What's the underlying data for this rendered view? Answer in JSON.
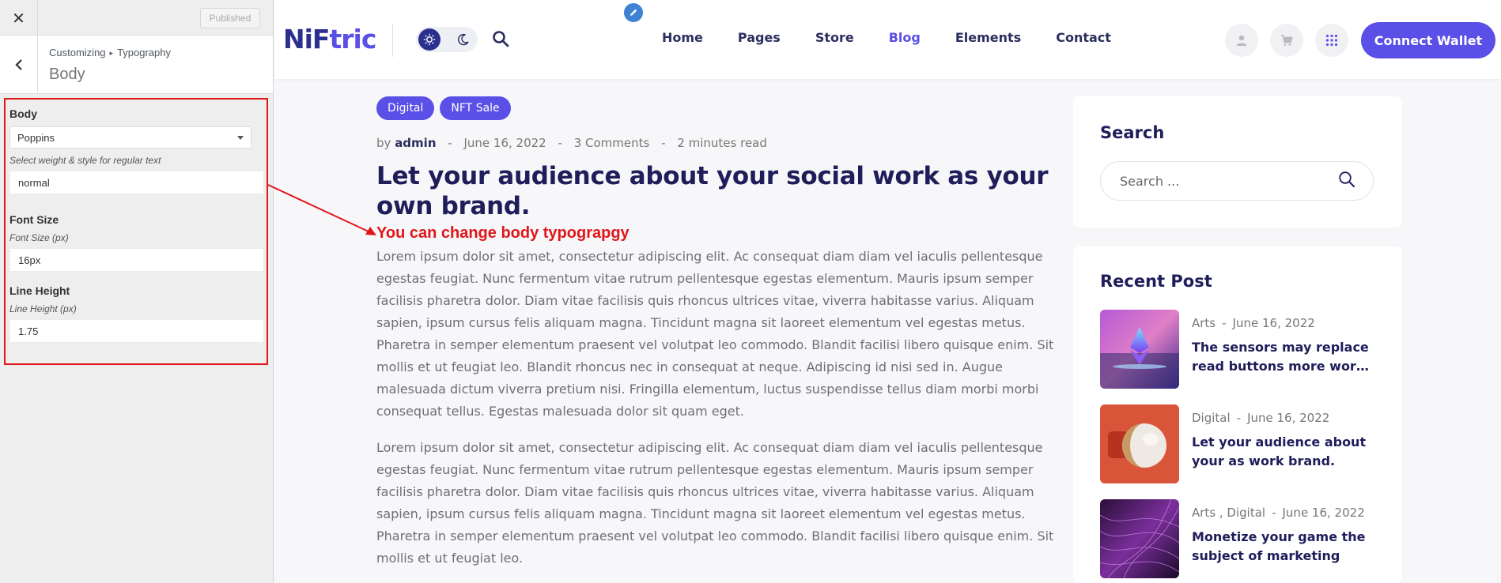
{
  "customizer": {
    "close_icon": "close-icon",
    "published_label": "Published",
    "breadcrumb_root": "Customizing",
    "breadcrumb_leaf": "Typography",
    "section_title": "Body",
    "body_label": "Body",
    "font_family_value": "Poppins",
    "weight_desc": "Select weight & style for regular text",
    "weight_value": "normal",
    "font_size_label": "Font Size",
    "font_size_desc": "Font Size (px)",
    "font_size_value": "16px",
    "line_height_label": "Line Height",
    "line_height_desc": "Line Height (px)",
    "line_height_value": "1.75",
    "highlight_color": "#e0161a"
  },
  "header": {
    "logo_part1": "NiF",
    "logo_part2": "tric",
    "nav": [
      "Home",
      "Pages",
      "Store",
      "Blog",
      "Elements",
      "Contact"
    ],
    "active_nav": "Blog",
    "cta_label": "Connect Wallet",
    "accent_color": "#5a4fe6"
  },
  "post": {
    "tags": [
      "Digital",
      "NFT Sale"
    ],
    "meta_by": "by",
    "meta_author": "admin",
    "meta_date": "June 16, 2022",
    "meta_comments": "3 Comments",
    "meta_read": "2 minutes read",
    "title": "Let your audience about your social work as your own brand.",
    "annotation": "You can change body typograpgy",
    "paragraph1": "Lorem ipsum dolor sit amet, consectetur adipiscing elit. Ac consequat diam diam vel iaculis pellentesque egestas feugiat. Nunc fermentum vitae rutrum pellentesque egestas elementum. Mauris ipsum semper facilisis pharetra dolor. Diam vitae facilisis quis rhoncus ultrices vitae, viverra habitasse varius. Aliquam sapien, ipsum cursus felis aliquam magna. Tincidunt magna sit laoreet elementum vel egestas metus. Pharetra in semper elementum praesent vel volutpat leo commodo. Blandit facilisi libero quisque enim. Sit mollis et ut feugiat leo. Blandit rhoncus nec in consequat at neque. Adipiscing id nisi sed in. Augue malesuada dictum viverra pretium nisi. Fringilla elementum, luctus suspendisse tellus diam morbi morbi consequat tellus. Egestas malesuada dolor sit quam eget.",
    "paragraph2": "Lorem ipsum dolor sit amet, consectetur adipiscing elit. Ac consequat diam diam vel iaculis pellentesque egestas feugiat. Nunc fermentum vitae rutrum pellentesque egestas elementum. Mauris ipsum semper facilisis pharetra dolor. Diam vitae facilisis quis rhoncus ultrices vitae, viverra habitasse varius. Aliquam sapien, ipsum cursus felis aliquam magna. Tincidunt magna sit laoreet elementum vel egestas metus. Pharetra in semper elementum praesent vel volutpat leo commodo. Blandit facilisi libero quisque enim. Sit mollis et ut feugiat leo."
  },
  "sidebar": {
    "search_title": "Search",
    "search_placeholder": "Search ...",
    "recent_title": "Recent Post",
    "recent": [
      {
        "category": "Arts",
        "date": "June 16, 2022",
        "title_l1": "The sensors may replace",
        "title_l2": "read buttons more work the"
      },
      {
        "category": "Digital",
        "date": "June 16, 2022",
        "title_l1": "Let your audience about",
        "title_l2": "your as work brand."
      },
      {
        "category": "Arts , Digital",
        "date": "June 16, 2022",
        "title_l1": "Monetize your game the",
        "title_l2": "subject of marketing"
      }
    ]
  }
}
